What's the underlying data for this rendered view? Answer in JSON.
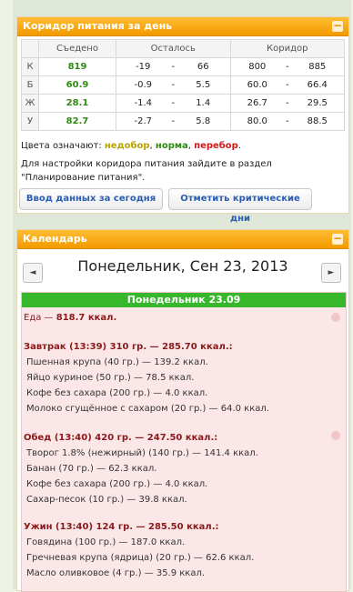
{
  "corridor": {
    "title": "Коридор питания за день",
    "headers": {
      "eaten": "Съедено",
      "left": "Осталось",
      "corridor": "Коридор"
    },
    "rows": [
      {
        "letter": "К",
        "eaten": "819",
        "left_min": "-19",
        "left_max": "66",
        "cor_min": "800",
        "cor_max": "885"
      },
      {
        "letter": "Б",
        "eaten": "60.9",
        "left_min": "-0.9",
        "left_max": "5.5",
        "cor_min": "60.0",
        "cor_max": "66.4"
      },
      {
        "letter": "Ж",
        "eaten": "28.1",
        "left_min": "-1.4",
        "left_max": "1.4",
        "cor_min": "26.7",
        "cor_max": "29.5"
      },
      {
        "letter": "У",
        "eaten": "82.7",
        "left_min": "-2.7",
        "left_max": "5.8",
        "cor_min": "80.0",
        "cor_max": "88.5"
      }
    ],
    "dash": "-",
    "legend": {
      "prefix": "Цвета означают:",
      "under": "недобор",
      "norm": "норма",
      "over": "перебор",
      "sep": ",",
      "end": "."
    },
    "note": "Для настройки коридора питания зайдите в раздел \"Планирование питания\".",
    "btn_enter": "Ввод данных за сегодня",
    "btn_critical": "Отметить критические дни"
  },
  "calendar": {
    "title": "Календарь",
    "prev": "◄",
    "next": "►",
    "date": "Понедельник, Сен 23, 2013",
    "day_label": "Понедельник 23.09",
    "food_prefix": "Еда",
    "food_total": "818.7 ккал.",
    "meals": [
      {
        "title": "Завтрак (13:39) 310 гр. — 285.70 ккал.:",
        "items": [
          "Пшенная крупа (40 гр.) — 139.2 ккал.",
          "Яйцо куриное (50 гр.) — 78.5 ккал.",
          "Кофе без сахара (200 гр.) — 4.0 ккал.",
          "Молоко сгущённое с сахаром (20 гр.) — 64.0 ккал."
        ]
      },
      {
        "title": "Обед (13:40) 420 гр. — 247.50 ккал.:",
        "items": [
          "Творог 1.8% (нежирный) (140 гр.) — 141.4 ккал.",
          "Банан (70 гр.) — 62.3 ккал.",
          "Кофе без сахара (200 гр.) — 4.0 ккал.",
          "Сахар-песок (10 гр.) — 39.8 ккал."
        ]
      },
      {
        "title": "Ужин (13:40) 124 гр. — 285.50 ккал.:",
        "items": [
          "Говядина (100 гр.) — 187.0 ккал.",
          "Гречневая крупа (ядрица) (20 гр.) — 62.6 ккал.",
          "Масло оливковое (4 гр.) — 35.9 ккал."
        ]
      }
    ]
  },
  "colors": {
    "header": "#f29a00",
    "green_bar": "#36b72c",
    "under": "#b8a300",
    "norm": "#2e8b12",
    "over": "#d01a1a",
    "link": "#2a5db0"
  }
}
